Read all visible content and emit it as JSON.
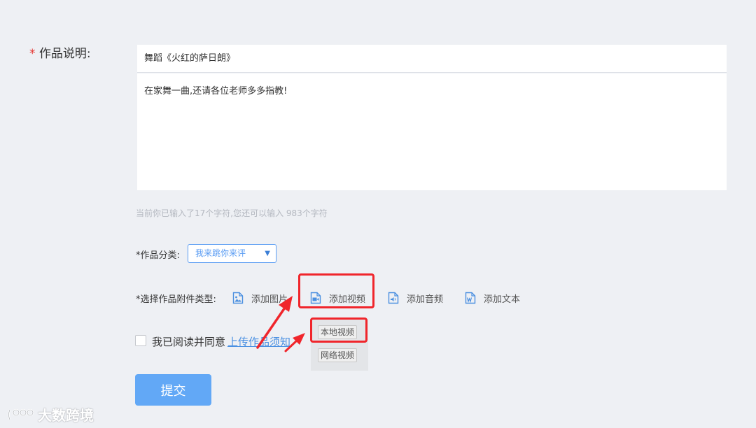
{
  "form": {
    "description_label": "作品说明:",
    "required_mark": "*",
    "title_value": "舞蹈《火红的萨日朗》",
    "content_value": "在家舞一曲,还请各位老师多多指教!",
    "char_counter": "当前你已输入了17个字符,您还可以输入 983个字符",
    "category": {
      "label": "*作品分类:",
      "selected": "我来跳你来评",
      "caret": "▼"
    },
    "attachment": {
      "label": "*选择作品附件类型:",
      "options": [
        {
          "label": "添加图片",
          "icon": "image-file-icon"
        },
        {
          "label": "添加视频",
          "icon": "video-file-icon"
        },
        {
          "label": "添加音频",
          "icon": "audio-file-icon"
        },
        {
          "label": "添加文本",
          "icon": "word-file-icon"
        }
      ]
    },
    "video_dropdown": {
      "local": "本地视频",
      "online": "网络视频"
    },
    "agreement": {
      "text": "我已阅读并同意",
      "link": "上传作品须知"
    },
    "submit_label": "提交"
  },
  "watermark": {
    "text": "大数跨境"
  },
  "colors": {
    "background": "#eef0f4",
    "accent": "#5b9df3",
    "submit": "#62a8f6",
    "highlight": "#f0252b",
    "required": "#e5322d"
  }
}
